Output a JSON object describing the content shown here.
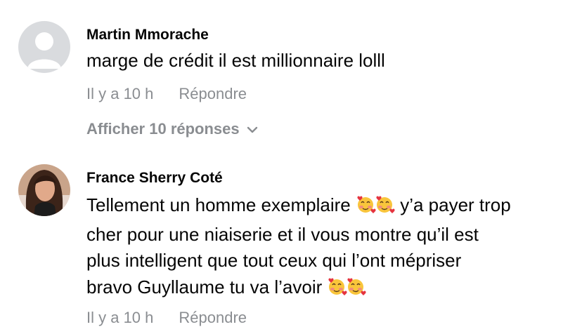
{
  "comments": [
    {
      "author": "Martin Mmorache",
      "text": "marge de crédit il est millionnaire lolll",
      "time": "Il y a 10 h",
      "reply_label": "Répondre",
      "view_replies_label": "Afficher 10 réponses"
    },
    {
      "author": "France Sherry Coté",
      "text_line1_a": "Tellement un homme exemplaire ",
      "text_line1_b": " y’a payer trop",
      "text_line2": "cher pour une niaiserie et il vous montre qu’il est",
      "text_line3": "plus intelligent que tout ceux qui l’ont mépriser",
      "text_line4": "bravo Guyllaume tu va l’avoir ",
      "time": "Il y a 10 h",
      "reply_label": "Répondre"
    }
  ],
  "icons": {
    "default_avatar": "default-avatar-icon",
    "emoji": "smiling-face-with-hearts-icon",
    "chevron": "chevron-down-icon"
  },
  "colors": {
    "meta_gray": "#8a8d91",
    "avatar_placeholder_bg": "#d9dbde"
  }
}
